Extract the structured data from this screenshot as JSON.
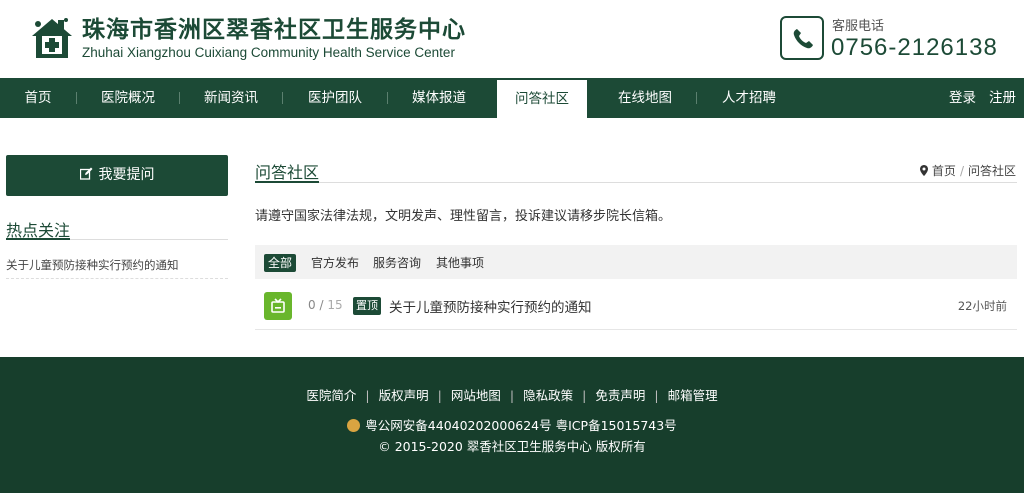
{
  "header": {
    "title_cn": "珠海市香洲区翠香社区卫生服务中心",
    "title_en": "Zhuhai Xiangzhou Cuixiang Community Health Service Center",
    "hotline_label": "客服电话",
    "hotline_number": "0756-2126138"
  },
  "nav": {
    "items": [
      {
        "label": "首页"
      },
      {
        "label": "医院概况"
      },
      {
        "label": "新闻资讯"
      },
      {
        "label": "医护团队"
      },
      {
        "label": "媒体报道"
      },
      {
        "label": "问答社区",
        "active": true
      },
      {
        "label": "在线地图"
      },
      {
        "label": "人才招聘"
      }
    ],
    "login": "登录",
    "register": "注册"
  },
  "sidebar": {
    "ask_button": "我要提问",
    "hot_title": "热点关注",
    "hot_items": [
      "关于儿童预防接种实行预约的通知"
    ]
  },
  "main": {
    "section_title": "问答社区",
    "breadcrumb": {
      "home": "首页",
      "current": "问答社区"
    },
    "notice": "请遵守国家法律法规，文明发声、理性留言，投诉建议请移步院长信箱。",
    "filters": [
      "全部",
      "官方发布",
      "服务咨询",
      "其他事项"
    ],
    "active_filter": "全部",
    "posts": [
      {
        "answers": "0",
        "views": "15",
        "tag": "置顶",
        "title": "关于儿童预防接种实行预约的通知",
        "time": "22小时前"
      }
    ]
  },
  "footer": {
    "links": [
      "医院简介",
      "版权声明",
      "网站地图",
      "隐私政策",
      "免责声明",
      "邮箱管理"
    ],
    "icp": "粤公网安备44040202000624号 粤ICP备15015743号",
    "copyright": "© 2015-2020 翠香社区卫生服务中心 版权所有"
  },
  "colors": {
    "brand_green": "#1c4a36",
    "footer_green": "#173e2c",
    "icon_green": "#69b62c"
  }
}
